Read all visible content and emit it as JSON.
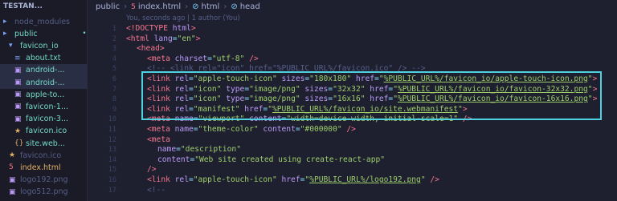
{
  "explorer": {
    "header": "TESTAN...",
    "items": [
      {
        "label": "node_modules",
        "kind": "folder",
        "indent": 0,
        "badge": "",
        "color": "#565f89"
      },
      {
        "label": "public",
        "kind": "folder",
        "indent": 0,
        "badge": "•",
        "color": "#73daca"
      },
      {
        "label": "favicon_io",
        "kind": "folder-open",
        "indent": 1,
        "badge": "•",
        "color": "#73daca"
      },
      {
        "label": "about.txt",
        "kind": "txt",
        "indent": 2,
        "badge": "U",
        "color": "#73daca"
      },
      {
        "label": "android-...",
        "kind": "img",
        "indent": 2,
        "badge": "U",
        "color": "#73daca"
      },
      {
        "label": "android-...",
        "kind": "img",
        "indent": 2,
        "badge": "U",
        "color": "#73daca"
      },
      {
        "label": "apple-to...",
        "kind": "img",
        "indent": 2,
        "badge": "U",
        "color": "#73daca"
      },
      {
        "label": "favicon-1...",
        "kind": "img",
        "indent": 2,
        "badge": "U",
        "color": "#73daca"
      },
      {
        "label": "favicon-3...",
        "kind": "img",
        "indent": 2,
        "badge": "U",
        "color": "#73daca"
      },
      {
        "label": "favicon.ico",
        "kind": "star",
        "indent": 2,
        "badge": "U",
        "color": "#73daca"
      },
      {
        "label": "site.web...",
        "kind": "json",
        "indent": 2,
        "badge": "U",
        "color": "#73daca"
      },
      {
        "label": "favicon.ico",
        "kind": "star",
        "indent": 1,
        "badge": "",
        "color": "#565f89"
      },
      {
        "label": "index.html",
        "kind": "html",
        "indent": 1,
        "badge": "M",
        "color": "#e0af68"
      },
      {
        "label": "logo192.png",
        "kind": "img",
        "indent": 1,
        "badge": "",
        "color": "#565f89"
      },
      {
        "label": "logo512.png",
        "kind": "img",
        "indent": 1,
        "badge": "",
        "color": "#565f89"
      }
    ]
  },
  "breadcrumb": [
    "public",
    "index.html",
    "html",
    "head"
  ],
  "blame": "You, seconds ago | 1 author (You)",
  "lines": [
    {
      "n": "1",
      "parts": [
        [
          "t",
          "<!DOCTYPE "
        ],
        [
          "a",
          "html"
        ],
        [
          "t",
          ">"
        ]
      ],
      "indent": 0
    },
    {
      "n": "2",
      "parts": [
        [
          "t",
          "<html "
        ],
        [
          "a",
          "lang"
        ],
        [
          "p",
          "="
        ],
        [
          "s",
          "\"en\""
        ],
        [
          "t",
          ">"
        ]
      ],
      "indent": 0
    },
    {
      "n": "3",
      "parts": [
        [
          "t",
          "<head>"
        ]
      ],
      "indent": 1
    },
    {
      "n": "4",
      "parts": [
        [
          "t",
          "<meta "
        ],
        [
          "a",
          "charset"
        ],
        [
          "p",
          "="
        ],
        [
          "s",
          "\"utf-8\""
        ],
        [
          "t",
          " />"
        ]
      ],
      "indent": 2
    },
    {
      "n": "5",
      "parts": [
        [
          "c",
          "<!-- <link rel=\"icon\" href=\"%PUBLIC_URL%/favicon.ico\" /> -->"
        ]
      ],
      "indent": 2
    },
    {
      "n": "6",
      "parts": [
        [
          "t",
          "<link "
        ],
        [
          "a",
          "rel"
        ],
        [
          "p",
          "="
        ],
        [
          "s",
          "\"apple-touch-icon\""
        ],
        [
          "a",
          " sizes"
        ],
        [
          "p",
          "="
        ],
        [
          "s",
          "\"180x180\""
        ],
        [
          "a",
          " href"
        ],
        [
          "p",
          "="
        ],
        [
          "s",
          "\""
        ],
        [
          "u",
          "%PUBLIC_URL%/favicon_io/apple-touch-icon.png"
        ],
        [
          "s",
          "\""
        ],
        [
          "t",
          ">"
        ]
      ],
      "indent": 2
    },
    {
      "n": "7",
      "parts": [
        [
          "t",
          "<link "
        ],
        [
          "a",
          "rel"
        ],
        [
          "p",
          "="
        ],
        [
          "s",
          "\"icon\""
        ],
        [
          "a",
          " type"
        ],
        [
          "p",
          "="
        ],
        [
          "s",
          "\"image/png\""
        ],
        [
          "a",
          " sizes"
        ],
        [
          "p",
          "="
        ],
        [
          "s",
          "\"32x32\""
        ],
        [
          "a",
          " href"
        ],
        [
          "p",
          "="
        ],
        [
          "s",
          "\""
        ],
        [
          "u",
          "%PUBLIC_URL%/favicon_io/favicon-32x32.png"
        ],
        [
          "s",
          "\""
        ],
        [
          "t",
          ">"
        ]
      ],
      "indent": 2
    },
    {
      "n": "8",
      "parts": [
        [
          "t",
          "<link "
        ],
        [
          "a",
          "rel"
        ],
        [
          "p",
          "="
        ],
        [
          "s",
          "\"icon\""
        ],
        [
          "a",
          " type"
        ],
        [
          "p",
          "="
        ],
        [
          "s",
          "\"image/png\""
        ],
        [
          "a",
          " sizes"
        ],
        [
          "p",
          "="
        ],
        [
          "s",
          "\"16x16\""
        ],
        [
          "a",
          " href"
        ],
        [
          "p",
          "="
        ],
        [
          "s",
          "\""
        ],
        [
          "u",
          "%PUBLIC_URL%/favicon_io/favicon-16x16.png"
        ],
        [
          "s",
          "\""
        ],
        [
          "t",
          ">"
        ]
      ],
      "indent": 2
    },
    {
      "n": "9",
      "parts": [
        [
          "t",
          "<link "
        ],
        [
          "a",
          "rel"
        ],
        [
          "p",
          "="
        ],
        [
          "s",
          "\"manifest\""
        ],
        [
          "a",
          " href"
        ],
        [
          "p",
          "="
        ],
        [
          "s",
          "\""
        ],
        [
          "u",
          "%PUBLIC_URL%/favicon_io/site.webmanifest"
        ],
        [
          "s",
          "\""
        ],
        [
          "t",
          ">"
        ]
      ],
      "indent": 2
    },
    {
      "n": "10",
      "parts": [
        [
          "t",
          "<meta "
        ],
        [
          "a",
          "name"
        ],
        [
          "p",
          "="
        ],
        [
          "s",
          "\"viewport\""
        ],
        [
          "a",
          " content"
        ],
        [
          "p",
          "="
        ],
        [
          "s",
          "\"width=device-width, initial-scale=1\""
        ],
        [
          "t",
          " />"
        ]
      ],
      "indent": 2
    },
    {
      "n": "11",
      "parts": [
        [
          "t",
          "<meta "
        ],
        [
          "a",
          "name"
        ],
        [
          "p",
          "="
        ],
        [
          "s",
          "\"theme-color\""
        ],
        [
          "a",
          " content"
        ],
        [
          "p",
          "="
        ],
        [
          "s",
          "\"#000000\""
        ],
        [
          "t",
          " />"
        ]
      ],
      "indent": 2
    },
    {
      "n": "12",
      "parts": [
        [
          "t",
          "<meta"
        ]
      ],
      "indent": 2
    },
    {
      "n": "13",
      "parts": [
        [
          "a",
          "name"
        ],
        [
          "p",
          "="
        ],
        [
          "s",
          "\"description\""
        ]
      ],
      "indent": 3
    },
    {
      "n": "14",
      "parts": [
        [
          "a",
          "content"
        ],
        [
          "p",
          "="
        ],
        [
          "s",
          "\"Web site created using create-react-app\""
        ]
      ],
      "indent": 3
    },
    {
      "n": "15",
      "parts": [
        [
          "t",
          "/>"
        ]
      ],
      "indent": 2
    },
    {
      "n": "16",
      "parts": [
        [
          "t",
          "<link "
        ],
        [
          "a",
          "rel"
        ],
        [
          "p",
          "="
        ],
        [
          "s",
          "\"apple-touch-icon\""
        ],
        [
          "a",
          " href"
        ],
        [
          "p",
          "="
        ],
        [
          "s",
          "\""
        ],
        [
          "u",
          "%PUBLIC_URL%/logo192.png"
        ],
        [
          "s",
          "\""
        ],
        [
          "t",
          " />"
        ]
      ],
      "indent": 2
    },
    {
      "n": "17",
      "parts": [
        [
          "c",
          "<!--"
        ]
      ],
      "indent": 2
    }
  ]
}
